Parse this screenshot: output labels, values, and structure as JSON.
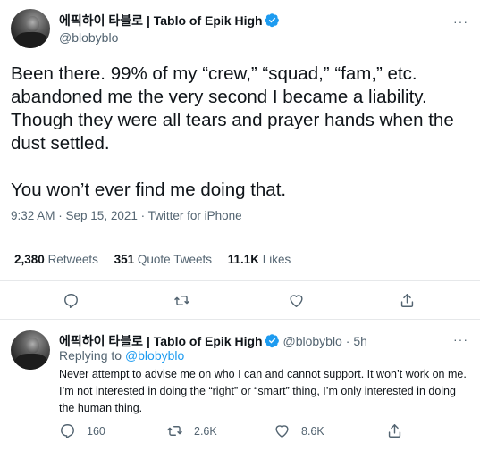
{
  "main_tweet": {
    "display_name": "에픽하이 타블로 | Tablo of Epik High",
    "handle": "@blobyblo",
    "more": "···",
    "text_p1": "Been there. 99% of my “crew,” “squad,” “fam,” etc. abandoned me the very second I became a liability. Though they were all tears and prayer hands when the dust settled.",
    "text_p2": "You won’t ever find me doing that.",
    "meta": "9:32 AM · Sep 15, 2021 · Twitter for iPhone",
    "stats": {
      "retweets_count": "2,380",
      "retweets_label": "Retweets",
      "quotes_count": "351",
      "quotes_label": "Quote Tweets",
      "likes_count": "11.1K",
      "likes_label": "Likes"
    },
    "actions": {
      "reply_icon": "reply-icon",
      "retweet_icon": "retweet-icon",
      "like_icon": "heart-icon",
      "share_icon": "share-icon"
    }
  },
  "reply_tweet": {
    "display_name": "에픽하이 타블로 | Tablo of Epik High",
    "handle": "@blobyblo",
    "separator": "·",
    "time": "5h",
    "more": "···",
    "replying_prefix": "Replying to",
    "replying_to": "@blobyblo",
    "text": "Never attempt to advise me on who I can and cannot support. It won’t work on me. I’m not interested in doing the “right” or “smart” thing, I’m only interested in doing the human thing.",
    "counts": {
      "replies": "160",
      "retweets": "2.6K",
      "likes": "8.6K"
    }
  },
  "colors": {
    "accent": "#1d9bf0",
    "muted": "#536471",
    "text": "#0f1419",
    "divider": "#e6e8ea"
  }
}
